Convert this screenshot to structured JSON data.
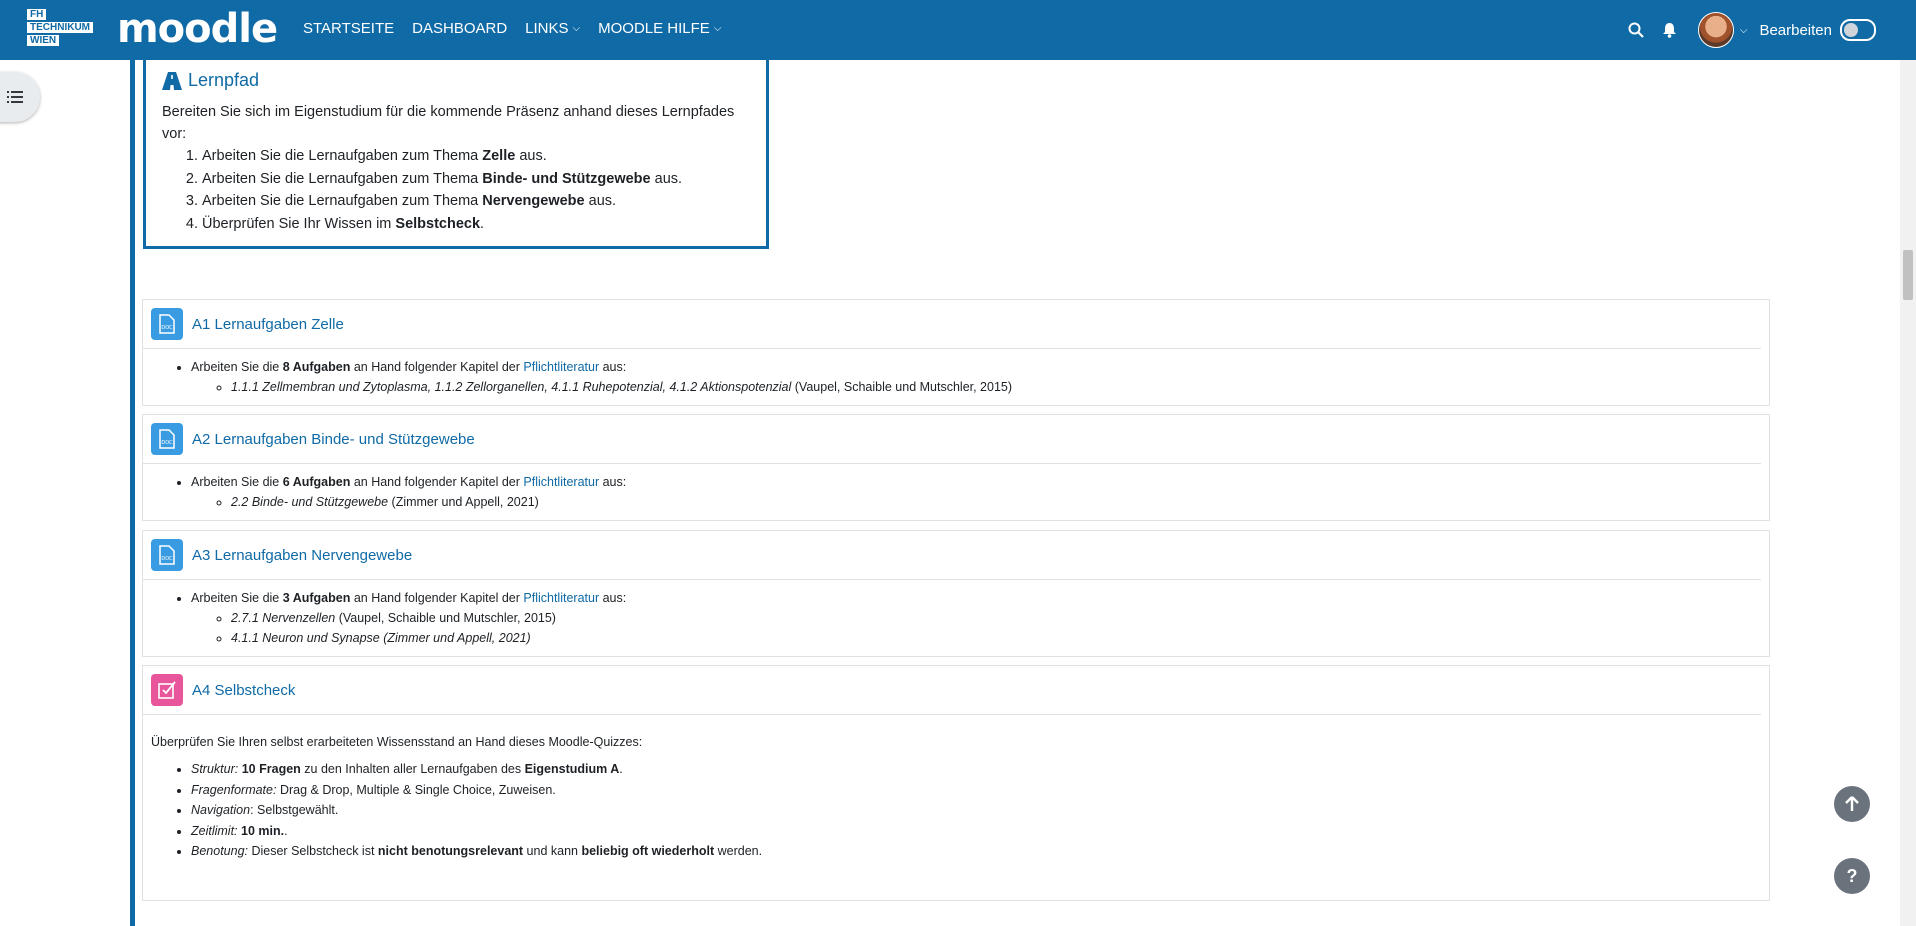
{
  "header": {
    "logo_lines": [
      "FH",
      "TECHNIKUM",
      "WIEN"
    ],
    "brand": "moodle",
    "nav": [
      {
        "label": "STARTSEITE",
        "has_menu": false
      },
      {
        "label": "DASHBOARD",
        "has_menu": false
      },
      {
        "label": "LINKS",
        "has_menu": true
      },
      {
        "label": "MOODLE HILFE",
        "has_menu": true
      }
    ],
    "edit_label": "Bearbeiten",
    "edit_mode": false
  },
  "lernpfad": {
    "title": "Lernpfad",
    "intro": "Bereiten Sie sich im Eigenstudium für die kommende Präsenz anhand dieses Lernpfades vor:",
    "steps": [
      {
        "pre": "Arbeiten Sie die Lernaufgaben zum Thema ",
        "bold": "Zelle",
        "post": " aus."
      },
      {
        "pre": "Arbeiten Sie die Lernaufgaben zum Thema ",
        "bold": "Binde- und Stützgewebe",
        "post": " aus."
      },
      {
        "pre": "Arbeiten Sie die Lernaufgaben zum Thema ",
        "bold": "Nervengewebe",
        "post": " aus."
      },
      {
        "pre": "Überprüfen Sie Ihr Wissen im ",
        "bold": "Selbstcheck",
        "post": "."
      }
    ]
  },
  "activities": [
    {
      "title": "A1 Lernaufgaben Zelle",
      "pre": "Arbeiten Sie die ",
      "bold": "8 Aufgaben",
      "mid": " an Hand folgender Kapitel der ",
      "link": "Pflichtliteratur",
      "post": " aus:",
      "refs": [
        {
          "italic": "1.1.1 Zellmembran und Zytoplasma, 1.1.2 Zellorganellen, 4.1.1 Ruhepotenzial, 4.1.2 Aktionspotenzial",
          "plain": " (Vaupel, Schaible und Mutschler, 2015)"
        }
      ]
    },
    {
      "title": "A2 Lernaufgaben Binde- und Stützgewebe",
      "pre": "Arbeiten Sie die ",
      "bold": "6 Aufgaben",
      "mid": " an Hand folgender Kapitel der ",
      "link": "Pflichtliteratur",
      "post": " aus:",
      "refs": [
        {
          "italic": "2.2 Binde- und Stützgewebe",
          "plain": " (Zimmer und Appell, 2021)"
        }
      ]
    },
    {
      "title": "A3 Lernaufgaben Nervengewebe",
      "pre": "Arbeiten Sie die ",
      "bold": "3 Aufgaben",
      "mid": " an Hand folgender Kapitel der ",
      "link": "Pflichtliteratur",
      "post": " aus:",
      "refs": [
        {
          "italic": "2.7.1 Nervenzellen",
          "plain": " (Vaupel, Schaible und Mutschler, 2015)"
        },
        {
          "italic": "4.1.1 Neuron und Synapse (Zimmer und Appell, 2021)",
          "plain": ""
        }
      ]
    }
  ],
  "quiz": {
    "title": "A4 Selbstcheck",
    "intro": "Überprüfen Sie Ihren selbst erarbeiteten Wissensstand an Hand dieses Moodle-Quizzes:",
    "items": [
      {
        "label": "Struktur:",
        "parts": [
          {
            "b": "10 Fragen"
          },
          {
            "t": " zu den Inhalten aller Lernaufgaben des "
          },
          {
            "b": "Eigenstudium A"
          },
          {
            "t": "."
          }
        ]
      },
      {
        "label": "Fragenformate:",
        "parts": [
          {
            "t": " Drag & Drop, Multiple & Single Choice, Zuweisen."
          }
        ]
      },
      {
        "label": "Navigation",
        "parts": [
          {
            "t": ": Selbstgewählt."
          }
        ]
      },
      {
        "label": "Zeitlimit:",
        "parts": [
          {
            "b": "10 min."
          },
          {
            "t": "."
          }
        ]
      },
      {
        "label": "Benotung:",
        "parts": [
          {
            "t": " Dieser Selbstcheck ist "
          },
          {
            "b": "nicht benotungsrelevant"
          },
          {
            "t": " und kann "
          },
          {
            "b": "beliebig oft wiederholt"
          },
          {
            "t": " werden."
          }
        ]
      }
    ]
  },
  "colors": {
    "brand": "#0f6aa6",
    "doc_icon": "#399be2",
    "quiz_icon": "#e8559b"
  },
  "icons": [
    "search-icon",
    "bell-icon",
    "list-icon",
    "road-icon",
    "document-icon",
    "checkbox-icon",
    "arrow-up-icon",
    "help-icon"
  ]
}
